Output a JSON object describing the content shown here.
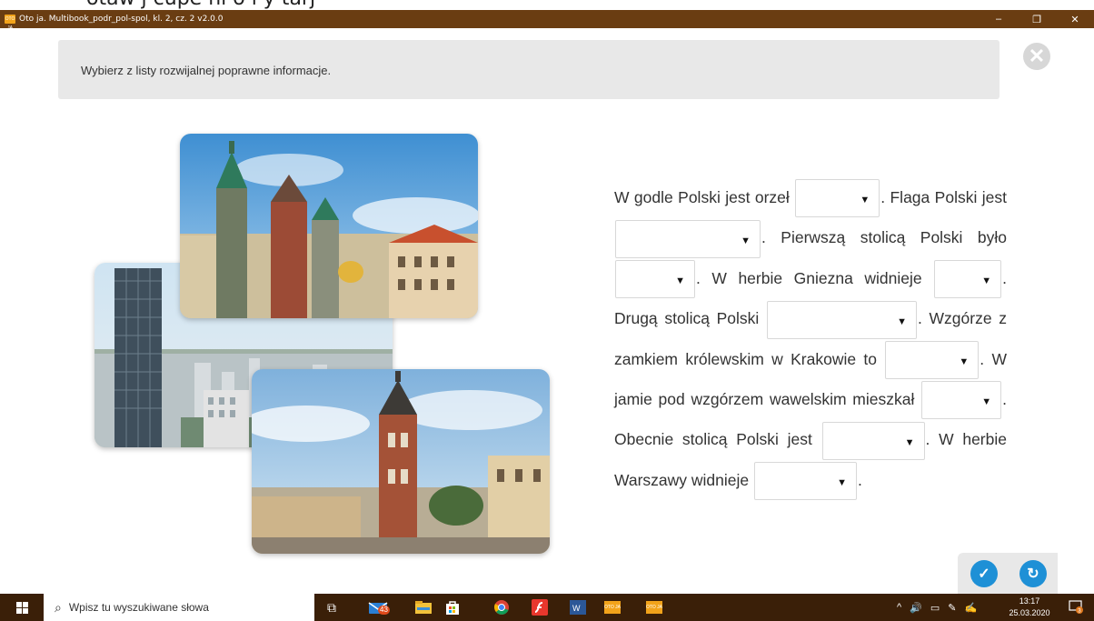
{
  "top_strip_text": "otaw j cupe ni o i y tarj",
  "window": {
    "title": "Oto ja. Multibook_podr_pol-spol, kl. 2, cz. 2 v2.0.0",
    "app_icon_text": "OTO JA",
    "minimize_glyph": "–",
    "maximize_glyph": "❐",
    "close_glyph": "✕"
  },
  "instruction": "Wybierz z listy rozwijalnej poprawne informacje.",
  "close_button_glyph": "✕",
  "exercise": {
    "segments": [
      "W godle Polski jest orzeł",
      ". Flaga Polski jest",
      ". Pierwszą stolicą Polski było",
      ". W herbie Gniezna widnieje",
      ". Drugą stolicą Polski",
      ". Wzgórze z zamkiem królewskim w Krakowie to",
      ". W jamie pod wzgórzem wawelskim mieszkał",
      ". Obecnie stolicą Polski jest",
      ". W herbie Warszawy widnieje",
      "."
    ],
    "dropdown_arrow": "▼",
    "dropdowns": [
      "",
      "",
      "",
      "",
      "",
      "",
      "",
      "",
      ""
    ]
  },
  "buttons": {
    "check_glyph": "✓",
    "reset_glyph": "↻"
  },
  "taskbar": {
    "search_placeholder": "Wpisz tu wyszukiwane słowa",
    "mail_badge": "43",
    "oto_label_1": "OTO JA",
    "oto_label_2": "OTO JA",
    "tray_icons": [
      "^",
      "🔊",
      "▭",
      "✎",
      "✍"
    ],
    "time": "13:17",
    "date": "25.03.2020",
    "notification_count": "3"
  },
  "colors": {
    "titlebar": "#6a3d12",
    "taskbar": "#3a1f08",
    "accent_blue": "#1e90d6",
    "instruction_bg": "#e8e8e8"
  }
}
